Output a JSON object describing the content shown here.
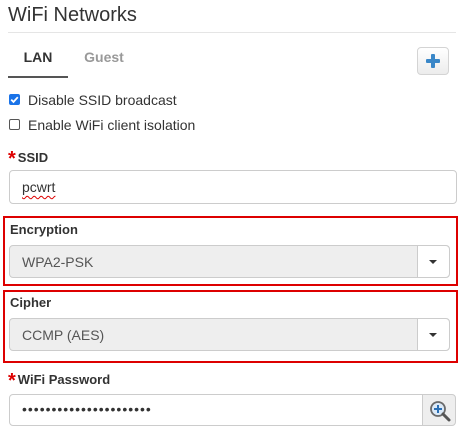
{
  "page": {
    "title": "WiFi Networks"
  },
  "tabs": [
    {
      "label": "LAN",
      "active": true
    },
    {
      "label": "Guest",
      "active": false
    }
  ],
  "add_button": {
    "icon": "plus-icon",
    "color": "#3a87c8"
  },
  "options": [
    {
      "label": "Disable SSID broadcast",
      "checked": true
    },
    {
      "label": "Enable WiFi client isolation",
      "checked": false
    }
  ],
  "ssid": {
    "required_mark": "*",
    "label": "SSID",
    "value": "pcwrt"
  },
  "encryption": {
    "label": "Encryption",
    "selected": "WPA2-PSK"
  },
  "cipher": {
    "label": "Cipher",
    "selected": "CCMP (AES)"
  },
  "password": {
    "required_mark": "*",
    "label": "WiFi Password",
    "masked_value": "••••••••••••••••••••••",
    "reveal_icon": "magnifier-plus-icon"
  },
  "colors": {
    "required": "#dd0000",
    "highlight_border": "#dd0000",
    "checkbox_checked": "#1a73e8"
  }
}
